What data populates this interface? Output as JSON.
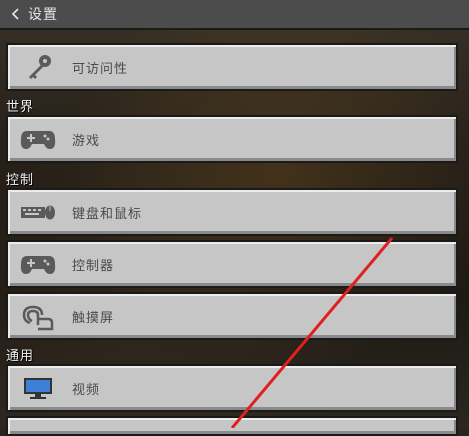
{
  "header": {
    "title": "设置",
    "back_icon": "chevron-left-icon"
  },
  "sections": {
    "world": "世界",
    "controls": "控制",
    "general": "通用"
  },
  "items": {
    "accessibility": {
      "label": "可访问性",
      "icon": "key-icon"
    },
    "game": {
      "label": "游戏",
      "icon": "gamepad-icon"
    },
    "keyboard_mouse": {
      "label": "键盘和鼠标",
      "icon": "keyboard-icon"
    },
    "controller": {
      "label": "控制器",
      "icon": "gamepad-icon"
    },
    "touchscreen": {
      "label": "触摸屏",
      "icon": "touch-icon"
    },
    "video": {
      "label": "视频",
      "icon": "monitor-icon"
    }
  },
  "colors": {
    "button_face": "#c6c6c6",
    "button_text": "#4a4a4a",
    "annotation_arrow": "#e02020"
  }
}
